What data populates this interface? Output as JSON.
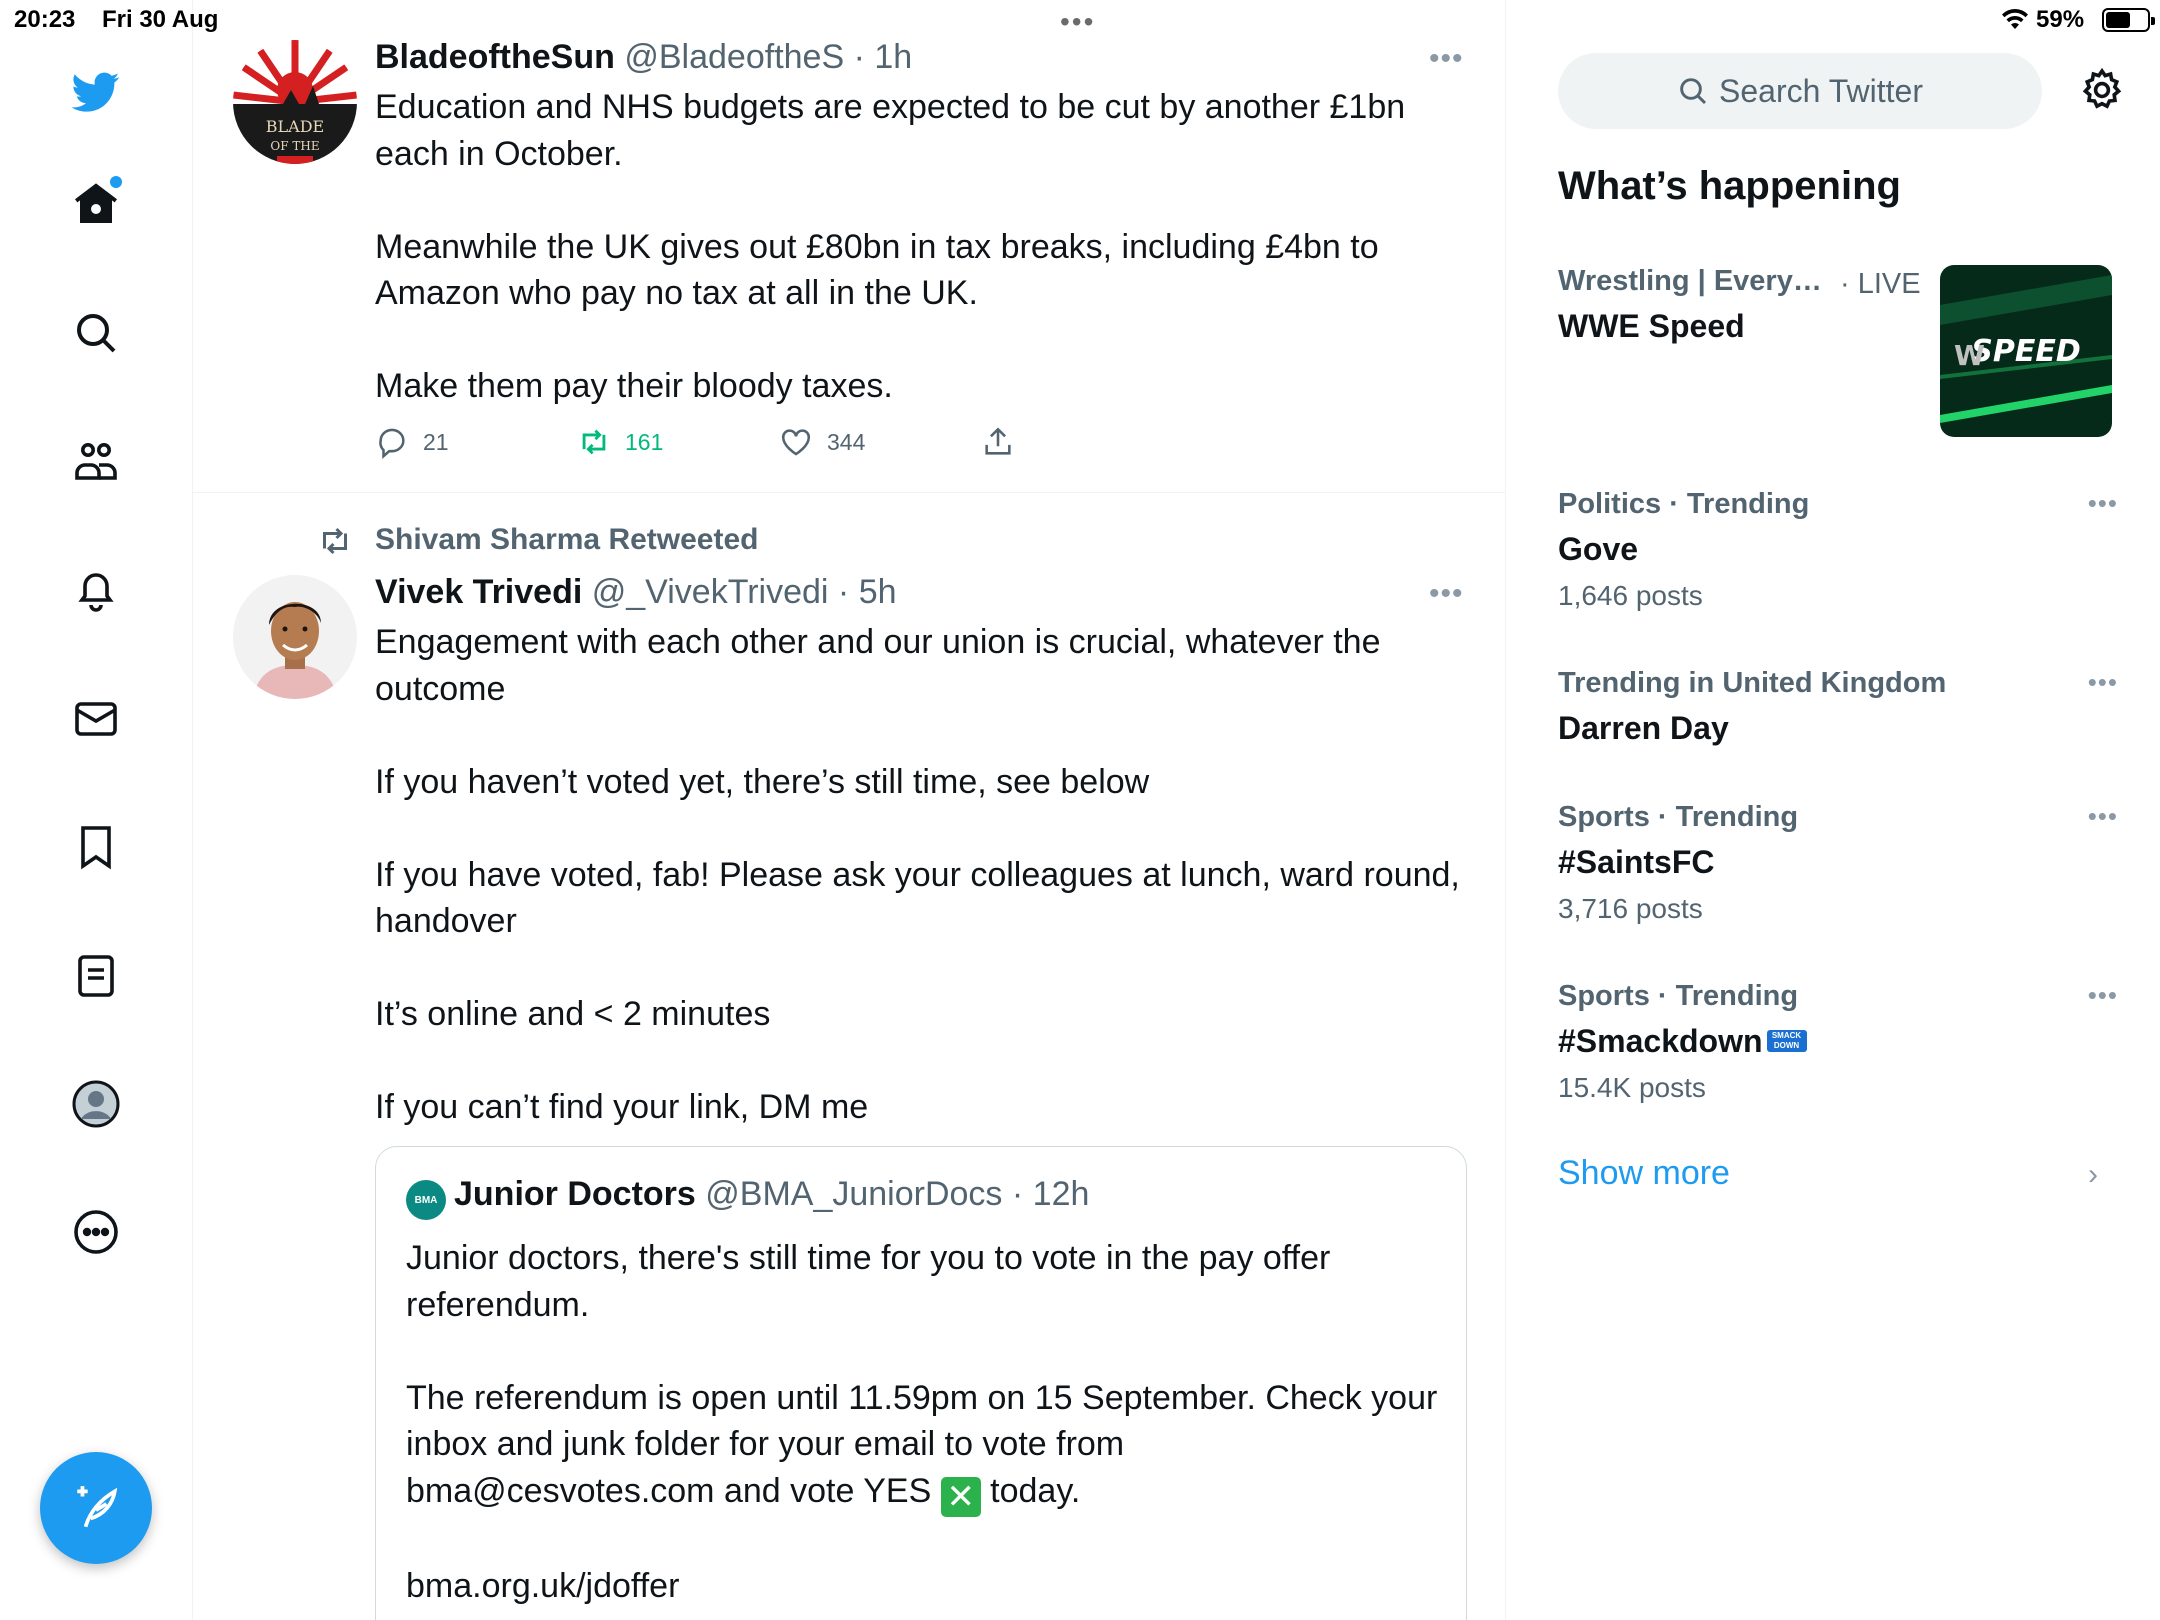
{
  "status_bar": {
    "time": "20:23",
    "date": "Fri 30 Aug",
    "battery": "59%",
    "battery_level": 0.59
  },
  "nav": {
    "items": [
      "twitter-logo",
      "home",
      "search",
      "communities",
      "notifications",
      "messages",
      "bookmarks",
      "lists",
      "profile",
      "more"
    ]
  },
  "tweets": [
    {
      "name": "BladeoftheSun",
      "handle": "@BladeoftheS",
      "time": "1h",
      "text": "Education and NHS budgets are expected to be cut by another £1bn\neach in October.\n\nMeanwhile the UK gives out £80bn in tax breaks, including £4bn to\nAmazon who pay no tax at all in the UK.\n\nMake them pay their bloody taxes.",
      "replies": "21",
      "retweets": "161",
      "likes": "344"
    },
    {
      "retweeted_by": "Shivam Sharma Retweeted",
      "name": "Vivek Trivedi",
      "handle": "@_VivekTrivedi",
      "time": "5h",
      "text": "Engagement with each other and our union is crucial, whatever the\noutcome\n\nIf you haven’t voted yet, there’s still time, see below\n\nIf you have voted, fab! Please ask your colleagues at lunch, ward round,\nhandover\n\nIt’s online and < 2 minutes\n\nIf you can’t find your link, DM me",
      "quote": {
        "avatar_text": "BMA",
        "name": "Junior Doctors",
        "handle": "@BMA_JuniorDocs",
        "time": "12h",
        "text_1": "Junior doctors, there's still time for you to vote in the pay offer\nreferendum.\n\nThe referendum is open until 11.59pm on 15 September. Check your\ninbox and junk folder for your email to vote from\nbma@cesvotes.com and vote YES",
        "emoji": "✕",
        "text_2": "today.",
        "link": "bma.org.uk/jdoffer"
      }
    }
  ],
  "sidebar": {
    "search_placeholder": "Search Twitter",
    "title": "What’s happening",
    "trends": [
      {
        "meta": "Wrestling | Every…",
        "live": "· LIVE",
        "name": "WWE Speed",
        "thumb_text": "SPEED"
      },
      {
        "meta": "Politics · Trending",
        "name": "Gove",
        "count": "1,646 posts"
      },
      {
        "meta": "Trending in United Kingdom",
        "name": "Darren Day"
      },
      {
        "meta": "Sports · Trending",
        "name": "#SaintsFC",
        "count": "3,716 posts"
      },
      {
        "meta": "Sports · Trending",
        "name": "#Smackdown",
        "badge": "SMACK DOWN",
        "count": "15.4K posts"
      }
    ],
    "show_more": "Show more"
  },
  "colors": {
    "accent": "#1d9bf0",
    "retweet_green": "#00ba7c",
    "secondary_text": "#536471"
  }
}
